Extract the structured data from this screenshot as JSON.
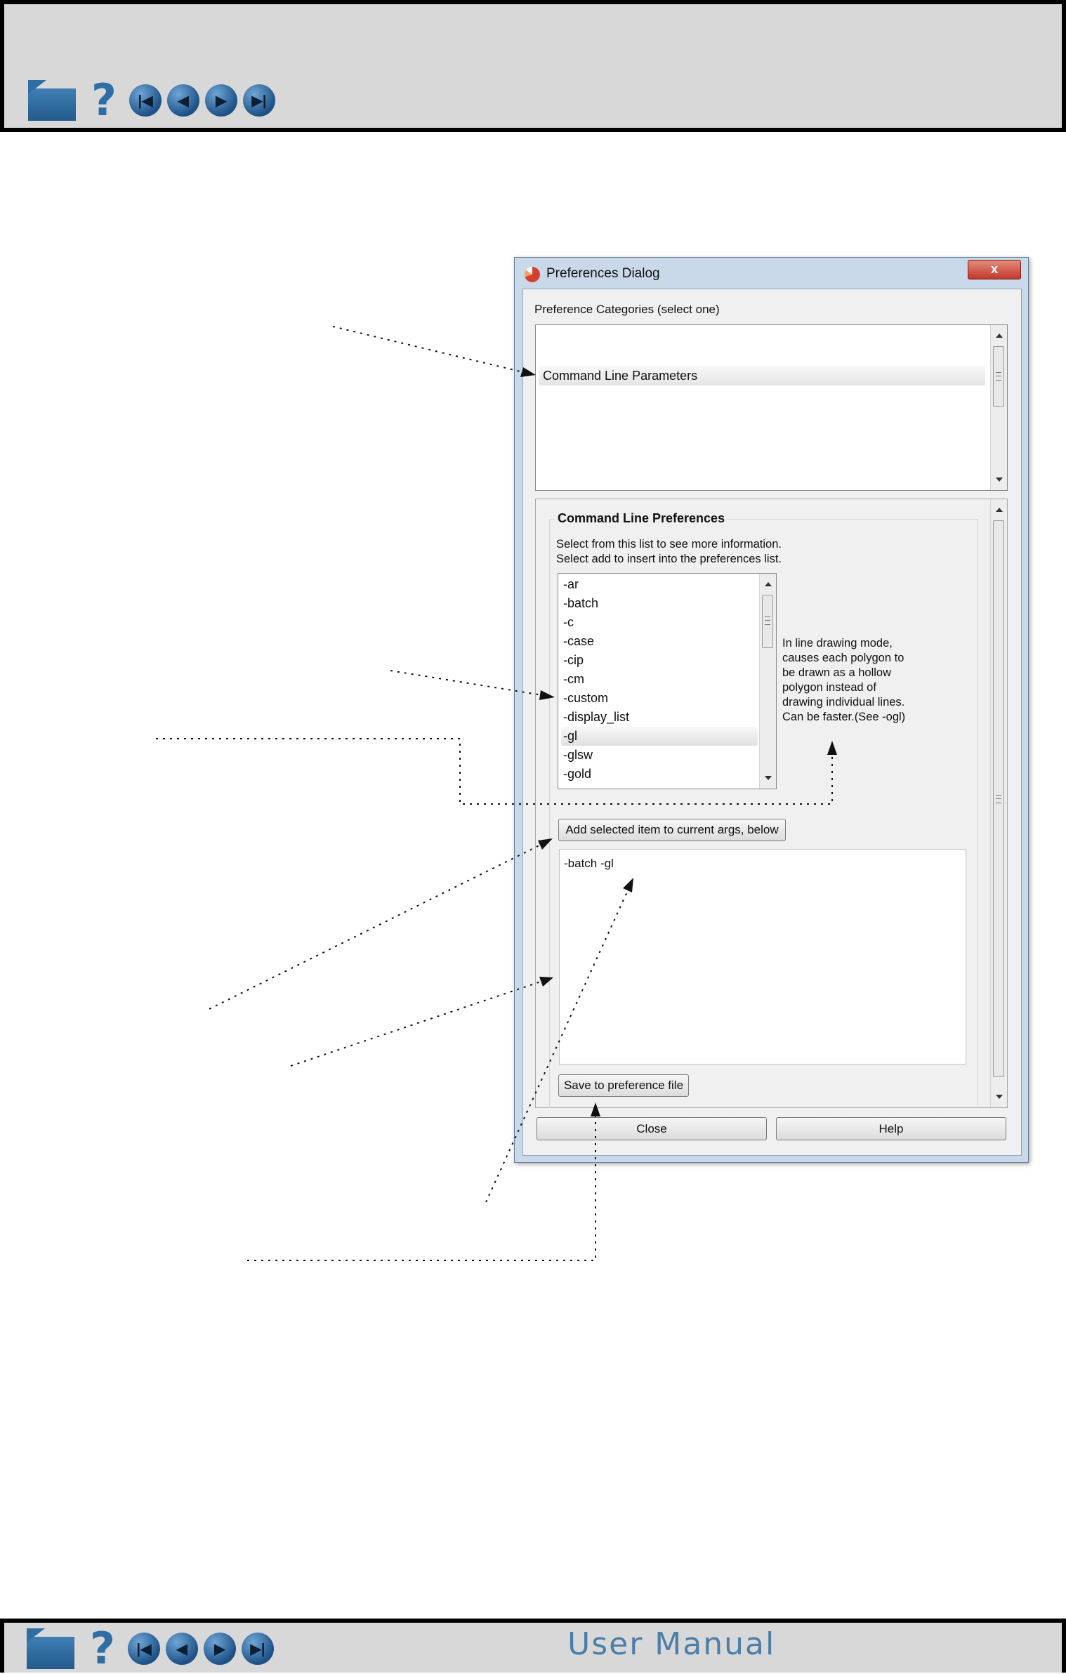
{
  "header": {
    "nav_icons": [
      "home-icon",
      "help-icon",
      "first-page-icon",
      "previous-page-icon",
      "next-page-icon",
      "last-page-icon"
    ]
  },
  "footer": {
    "manual_title": "User Manual"
  },
  "dialog": {
    "title": "Preferences Dialog",
    "close_glyph": "x",
    "categories_label": "Preference Categories (select one)",
    "selected_category": "Command Line Parameters",
    "group_title": "Command Line Preferences",
    "hint_line1": "Select from this list to see more information.",
    "hint_line2": "Select add to insert into the preferences list.",
    "params": [
      "-ar",
      "-batch",
      "-c",
      "-case",
      "-cip",
      "-cm",
      "-custom",
      "-display_list",
      "-gl",
      "-glsw",
      "-gold"
    ],
    "selected_param": "-gl",
    "description_lines": [
      "In line drawing mode,",
      "causes each polygon to",
      "be drawn as a hollow",
      "polygon instead of",
      "drawing individual lines.",
      "Can be faster.(See -ogl)"
    ],
    "add_button": "Add selected item to current args, below",
    "current_args": "-batch -gl",
    "save_button": "Save to preference file",
    "close_button": "Close",
    "help_button": "Help"
  },
  "colors": {
    "frame_blue": "#c9d9ea",
    "nav_icon_blue": "#2f6ea4",
    "header_grey": "#d8d8d8"
  }
}
